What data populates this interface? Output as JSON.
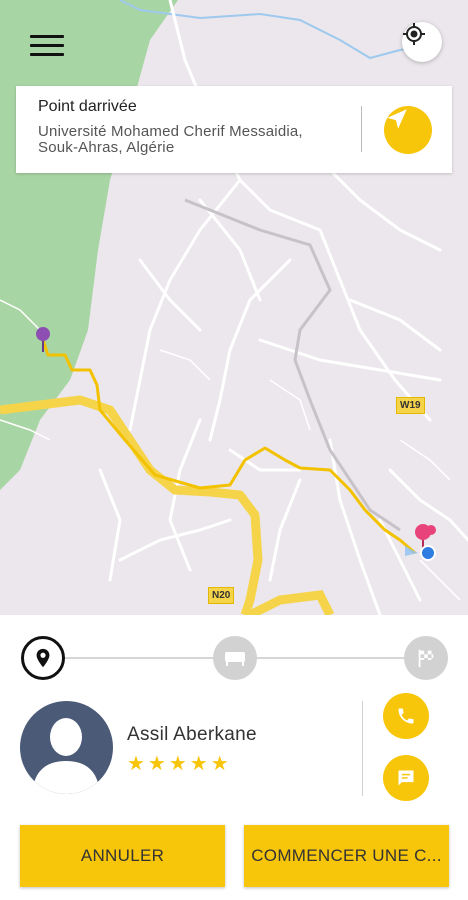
{
  "destination": {
    "title": "Point darrivée",
    "address": "Université Mohamed Cherif Messaidia, Souk-Ahras, Algérie"
  },
  "map": {
    "road_labels": [
      "W19",
      "N20"
    ],
    "route_color": "#f2c200",
    "forest_color": "#a8d5a4",
    "origin_pin_color": "#8e4fb3",
    "dest_pin_color": "#e8437a",
    "position_dot_color": "#2f7de1"
  },
  "trip_steps": [
    {
      "icon": "location-pin-icon",
      "state": "active"
    },
    {
      "icon": "bed-icon",
      "state": "inactive"
    },
    {
      "icon": "finish-flag-icon",
      "state": "inactive"
    }
  ],
  "driver": {
    "name": "Assil Aberkane",
    "rating_stars": "★★★★★",
    "rating": 5
  },
  "actions": {
    "cancel_label": "ANNULER",
    "start_label": "COMMENCER UNE C..."
  },
  "colors": {
    "accent": "#f7c50a"
  }
}
